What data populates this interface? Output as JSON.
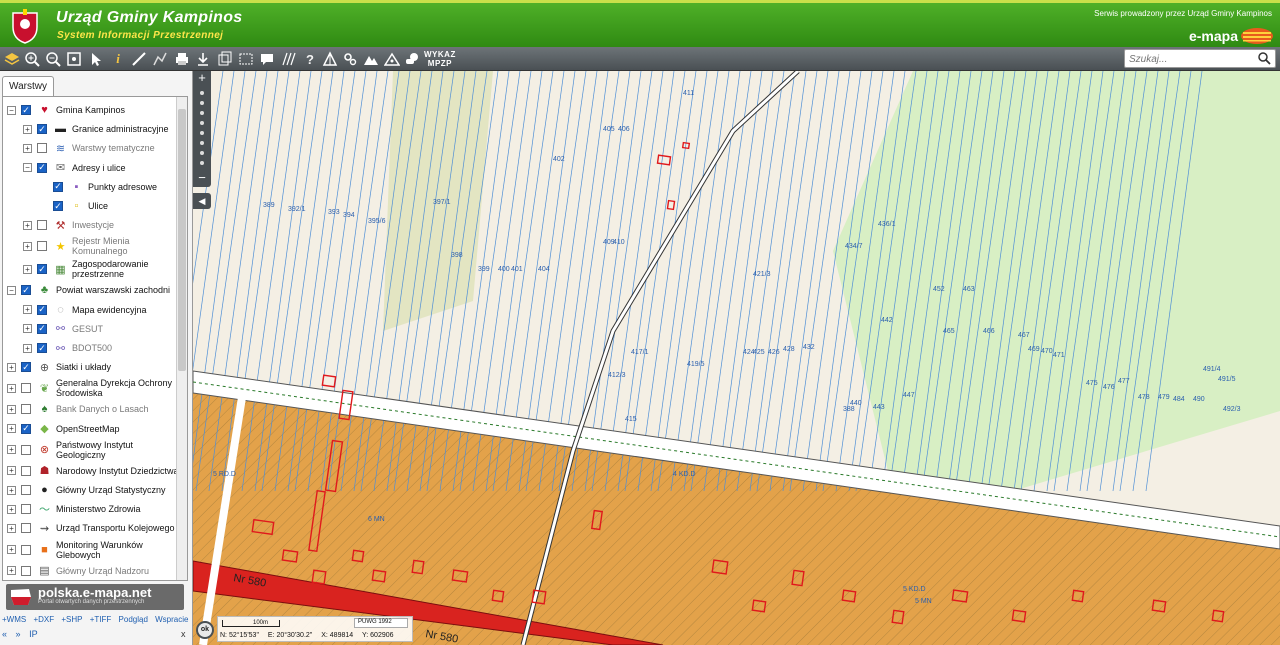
{
  "header": {
    "title": "Urząd Gminy Kampinos",
    "subtitle": "System Informacji Przestrzennej",
    "service_note": "Serwis prowadzony przez Urząd Gminy Kampinos",
    "brand": "e-mapa"
  },
  "toolbar": {
    "icons": [
      "layers-icon",
      "zoom-in-icon",
      "zoom-out-icon",
      "zoom-extent-icon",
      "pointer-icon",
      "info-icon",
      "measure-distance-icon",
      "measure-path-icon",
      "print-icon",
      "download-icon",
      "copy-icon",
      "select-area-icon",
      "comment-icon",
      "hatch-icon",
      "help-icon",
      "triangle-icon",
      "settings-icon",
      "mountain-icon",
      "terrain-icon",
      "weather-icon"
    ],
    "wykaz_line1": "WYKAZ",
    "wykaz_line2": "MPZP",
    "search_placeholder": "Szukaj..."
  },
  "panel": {
    "tab_label": "Warstwy",
    "layers": [
      {
        "label": "Gmina Kampinos",
        "level": 0,
        "checked": true,
        "expander": "−",
        "dim": false,
        "icon": "crest-icon"
      },
      {
        "label": "Granice administracyjne",
        "level": 1,
        "checked": true,
        "expander": "+",
        "dim": false,
        "icon": "boundary-icon"
      },
      {
        "label": "Warstwy tematyczne",
        "level": 1,
        "checked": false,
        "expander": "+",
        "dim": true,
        "icon": "stack-icon"
      },
      {
        "label": "Adresy i ulice",
        "level": 1,
        "checked": true,
        "expander": "−",
        "dim": false,
        "icon": "envelope-icon"
      },
      {
        "label": "Punkty adresowe",
        "level": 2,
        "checked": true,
        "expander": "",
        "dim": false,
        "icon": "point-icon"
      },
      {
        "label": "Ulice",
        "level": 2,
        "checked": true,
        "expander": "",
        "dim": false,
        "icon": "street-icon"
      },
      {
        "label": "Inwestycje",
        "level": 1,
        "checked": false,
        "expander": "+",
        "dim": true,
        "icon": "crane-icon"
      },
      {
        "label": "Rejestr Mienia\nKomunalnego",
        "level": 1,
        "checked": false,
        "expander": "+",
        "dim": true,
        "icon": "eu-icon"
      },
      {
        "label": "Zagospodarowanie\nprzestrzenne",
        "level": 1,
        "checked": true,
        "expander": "+",
        "dim": false,
        "icon": "plan-icon"
      },
      {
        "label": "Powiat warszawski zachodni",
        "level": 0,
        "checked": true,
        "expander": "−",
        "dim": false,
        "icon": "county-icon"
      },
      {
        "label": "Mapa ewidencyjna",
        "level": 1,
        "checked": true,
        "expander": "+",
        "dim": false,
        "icon": "cadastre-icon"
      },
      {
        "label": "GESUT",
        "level": 1,
        "checked": true,
        "expander": "+",
        "dim": true,
        "icon": "network-icon"
      },
      {
        "label": "BDOT500",
        "level": 1,
        "checked": true,
        "expander": "+",
        "dim": true,
        "icon": "network-icon"
      },
      {
        "label": "Siatki i układy",
        "level": 0,
        "checked": true,
        "expander": "+",
        "dim": false,
        "icon": "globe-icon"
      },
      {
        "label": "Generalna Dyrekcja Ochrony\nŚrodowiska",
        "level": 0,
        "checked": false,
        "expander": "+",
        "dim": false,
        "icon": "leaf-icon"
      },
      {
        "label": "Bank Danych o Lasach",
        "level": 0,
        "checked": false,
        "expander": "+",
        "dim": true,
        "icon": "tree-icon"
      },
      {
        "label": "OpenStreetMap",
        "level": 0,
        "checked": true,
        "expander": "+",
        "dim": false,
        "icon": "osm-icon"
      },
      {
        "label": "Państwowy Instytut\nGeologiczny",
        "level": 0,
        "checked": false,
        "expander": "+",
        "dim": false,
        "icon": "geology-icon"
      },
      {
        "label": "Narodowy Instytut Dziedzictwa",
        "level": 0,
        "checked": false,
        "expander": "+",
        "dim": false,
        "icon": "heritage-icon"
      },
      {
        "label": "Główny Urząd Statystyczny",
        "level": 0,
        "checked": false,
        "expander": "+",
        "dim": false,
        "icon": "statistics-icon"
      },
      {
        "label": "Ministerstwo Zdrowia",
        "level": 0,
        "checked": false,
        "expander": "+",
        "dim": false,
        "icon": "health-icon"
      },
      {
        "label": "Urząd Transportu Kolejowego",
        "level": 0,
        "checked": false,
        "expander": "+",
        "dim": false,
        "icon": "rail-icon"
      },
      {
        "label": "Monitoring Warunków\nGlebowych",
        "level": 0,
        "checked": false,
        "expander": "+",
        "dim": false,
        "icon": "soil-icon"
      },
      {
        "label": "Główny Urząd Nadzoru",
        "level": 0,
        "checked": false,
        "expander": "+",
        "dim": true,
        "icon": "supervision-icon"
      }
    ],
    "portal_name": "polska.e-mapa.net",
    "portal_sub": "Portal otwartych danych przestrzennych",
    "links": [
      "+WMS",
      "+DXF",
      "+SHP",
      "+TIFF",
      "Podgląd",
      "Wspracie"
    ],
    "nav": [
      "«",
      "»",
      "IP"
    ],
    "close": "x"
  },
  "map": {
    "zoom_in": "+",
    "zoom_out": "−",
    "collapse": "◀",
    "ok_label": "ok",
    "scale": "100m",
    "projection": "PUWG 1992",
    "lat": "N: 52°15'53\"",
    "lon": "E: 20°30'30.2\"",
    "x": "X: 489814",
    "y": "Y: 602906",
    "road_label": "Nr 580",
    "parcel_labels": [
      "411",
      "405",
      "406",
      "402",
      "397/1",
      "389",
      "392/1",
      "393",
      "394",
      "395/6",
      "398",
      "399",
      "400",
      "401",
      "404",
      "409",
      "410",
      "412/3",
      "415",
      "417/1",
      "419/5",
      "421/3",
      "424",
      "425",
      "426",
      "428",
      "432",
      "434/7",
      "436/1",
      "440",
      "442",
      "443",
      "447",
      "452",
      "463",
      "465",
      "466",
      "467",
      "469",
      "470",
      "471",
      "475",
      "476",
      "477",
      "478",
      "479",
      "484",
      "490",
      "491/4",
      "491/5",
      "492/3",
      "388",
      "4 KD.D",
      "5 KD.D",
      "6 MN",
      "5 MN",
      "5 RD.D"
    ]
  }
}
